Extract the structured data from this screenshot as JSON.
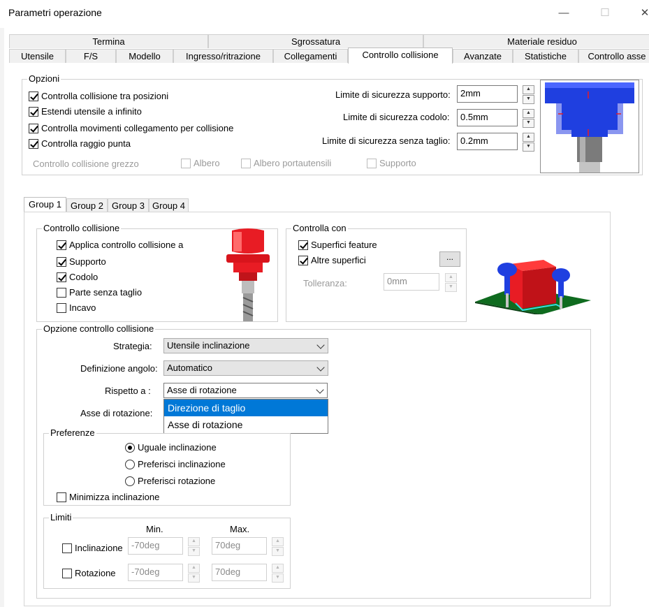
{
  "window": {
    "title": "Parametri operazione",
    "minimize": "—",
    "maximize": "☐",
    "close": "✕"
  },
  "tabs_top": [
    "Termina",
    "Sgrossatura",
    "Materiale residuo"
  ],
  "tabs_main": [
    "Utensile",
    "F/S",
    "Modello",
    "Ingresso/ritrazione",
    "Collegamenti",
    "Controllo collisione",
    "Avanzate",
    "Statistiche",
    "Controllo asse"
  ],
  "opzioni": {
    "label": "Opzioni",
    "checks": [
      "Controlla collisione tra posizioni",
      "Estendi utensile a infinito",
      "Controlla movimenti collegamento per collisione",
      "Controlla raggio punta"
    ],
    "grezzo_label": "Controllo collisione grezzo",
    "grezzo_checks": [
      "Albero",
      "Albero portautensili",
      "Supporto"
    ],
    "limits": [
      {
        "label": "Limite di sicurezza supporto:",
        "value": "2mm"
      },
      {
        "label": "Limite di sicurezza codolo:",
        "value": "0.5mm"
      },
      {
        "label": "Limite di sicurezza senza taglio:",
        "value": "0.2mm"
      }
    ]
  },
  "groups": [
    "Group 1",
    "Group 2",
    "Group 3",
    "Group 4"
  ],
  "controllo_collisione": {
    "label": "Controllo collisione",
    "checks": [
      {
        "label": "Applica controllo collisione a",
        "checked": true
      },
      {
        "label": "Supporto",
        "checked": true
      },
      {
        "label": "Codolo",
        "checked": true
      },
      {
        "label": "Parte senza taglio",
        "checked": false
      },
      {
        "label": "Incavo",
        "checked": false
      }
    ]
  },
  "controlla_con": {
    "label": "Controlla con",
    "checks": [
      "Superfici feature",
      "Altre superfici"
    ],
    "browse": "...",
    "tolleranza_label": "Tolleranza:",
    "tolleranza_value": "0mm"
  },
  "opzione_cc": {
    "label": "Opzione controllo collisione",
    "strategia_label": "Strategia:",
    "strategia_value": "Utensile inclinazione",
    "definizione_label": "Definizione angolo:",
    "definizione_value": "Automatico",
    "rispetto_label": "Rispetto a :",
    "rispetto_value": "Asse di rotazione",
    "asse_label": "Asse di rotazione:",
    "dropdown_options": [
      "Direzione di taglio",
      "Asse di rotazione"
    ]
  },
  "preferenze": {
    "label": "Preferenze",
    "radios": [
      "Uguale inclinazione",
      "Preferisci inclinazione",
      "Preferisci rotazione"
    ],
    "minimizza": "Minimizza inclinazione"
  },
  "limiti": {
    "label": "Limiti",
    "min_header": "Min.",
    "max_header": "Max.",
    "rows": [
      {
        "label": "Inclinazione",
        "min": "-70deg",
        "max": "70deg"
      },
      {
        "label": "Rotazione",
        "min": "-70deg",
        "max": "70deg"
      }
    ]
  },
  "colors": {
    "accent": "#0078d7",
    "holder_blue": "#1f3fe0",
    "holder_red": "#e81c24",
    "plate_green": "#0f6b1f"
  }
}
